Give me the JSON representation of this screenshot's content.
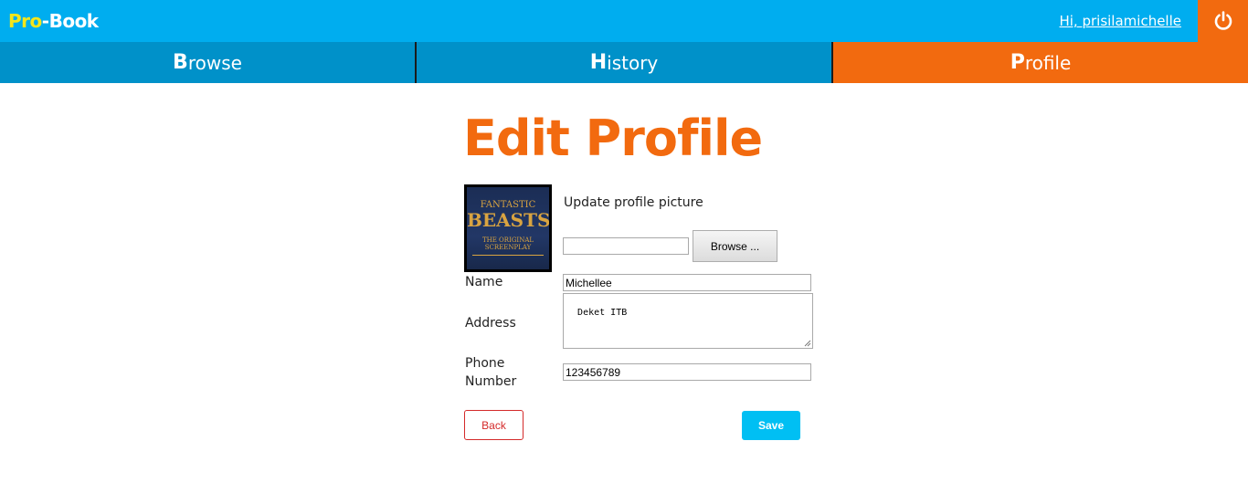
{
  "header": {
    "logo_pro": "Pro",
    "logo_dash": "-",
    "logo_book": "Book",
    "greeting": "Hi, prisilamichelle",
    "power_icon": "power-icon"
  },
  "nav": {
    "tabs": [
      {
        "cap": "B",
        "rest": "rowse"
      },
      {
        "cap": "H",
        "rest": "istory"
      },
      {
        "cap": "P",
        "rest": "rofile"
      }
    ],
    "active": "Profile"
  },
  "main": {
    "title": "Edit Profile",
    "avatar": {
      "line1": "FANTASTIC",
      "line2": "BEASTS",
      "line3": "THE ORIGINAL SCREENPLAY"
    },
    "update_picture_label": "Update profile picture",
    "file_value": "",
    "browse_label": "Browse ...",
    "name_label": "Name",
    "name_value": "Michellee",
    "address_label": "Address",
    "address_value": "Deket ITB",
    "phone_label": "Phone Number",
    "phone_value": "123456789",
    "back_label": "Back",
    "save_label": "Save"
  },
  "colors": {
    "header_blue": "#00adef",
    "nav_blue": "#0091c9",
    "accent_orange": "#f26a0f",
    "logo_yellow": "#f4e61b",
    "save_blue": "#00bff3",
    "back_red": "#d42a2a"
  }
}
